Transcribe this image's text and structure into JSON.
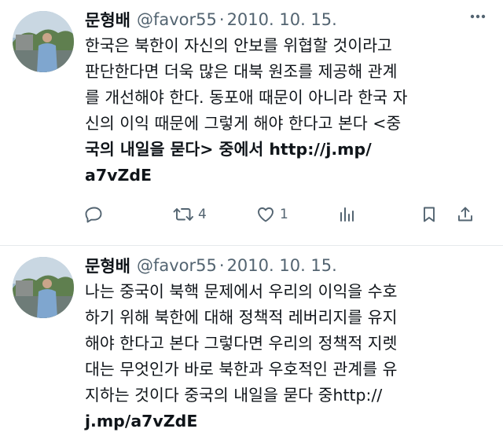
{
  "tweets": [
    {
      "author": {
        "name": "문형배",
        "handle": "@favor55"
      },
      "separator": "·",
      "date": "2010. 10. 15.",
      "lines": [
        "한국은 북한이 자신의 안보를 위협할 것이라고",
        "판단한다면 더욱 많은 대북 원조를 제공해 관계",
        "를 개선해야 한다. 동포애 때문이 아니라 한국 자",
        "신의 이익 때문에 그렇게 해야 한다고 본다 <중",
        "국의 내일을 묻다> 중에서 http://j.mp/",
        "a7vZdE"
      ],
      "actions": {
        "reply_icon": "reply-icon",
        "retweet_icon": "retweet-icon",
        "retweet_count": "4",
        "like_icon": "heart-icon",
        "like_count": "1",
        "views_icon": "views-icon",
        "bookmark_icon": "bookmark-icon",
        "share_icon": "share-icon"
      }
    },
    {
      "author": {
        "name": "문형배",
        "handle": "@favor55"
      },
      "separator": "·",
      "date": "2010. 10. 15.",
      "lines": [
        "나는 중국이 북핵 문제에서 우리의 이익을 수호",
        "하기 위해 북한에 대해 정책적 레버리지를 유지",
        "해야 한다고 본다 그렇다면 우리의 정책적 지렛",
        "대는 무엇인가 바로 북한과 우호적인 관계를 유",
        "지하는 것이다 중국의 내일을 묻다 중http://",
        "j.mp/a7vZdE"
      ]
    }
  ],
  "colors": {
    "text": "#0f1419",
    "secondary": "#536471",
    "divider": "#e6e9ec"
  }
}
